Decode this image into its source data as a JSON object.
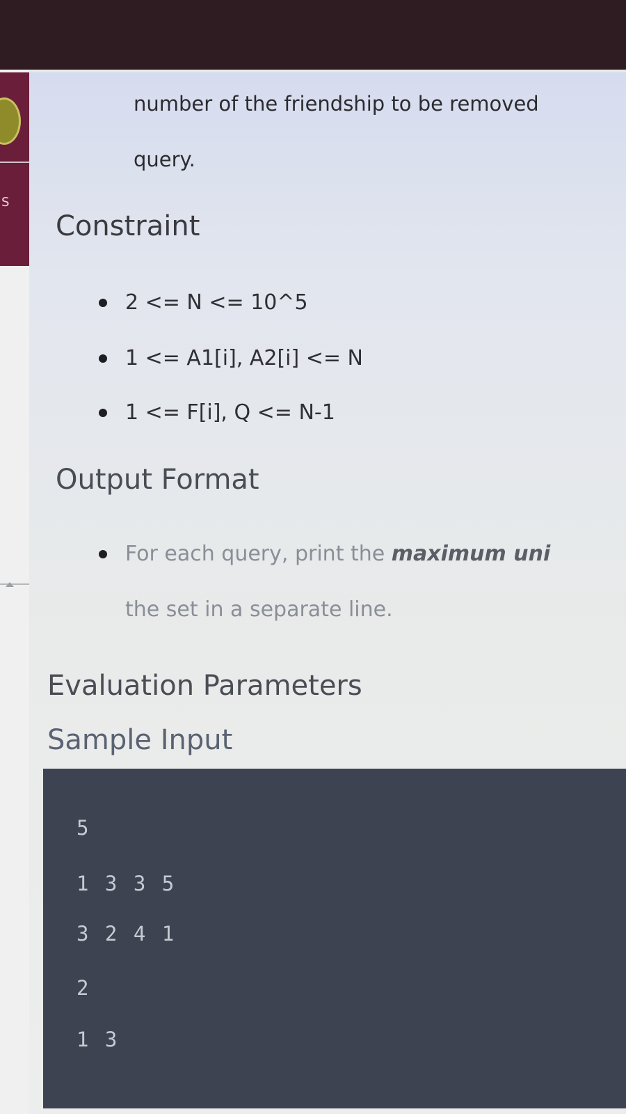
{
  "sidebar": {
    "partial_label": "S"
  },
  "problem": {
    "input_continuation": {
      "line1": "number of the friendship to be removed",
      "line2": "query."
    },
    "constraint": {
      "heading": "Constraint",
      "items": [
        "2 <= N <= 10^5",
        "1 <= A1[i], A2[i] <= N",
        "1 <= F[i], Q <= N-1"
      ]
    },
    "output_format": {
      "heading": "Output Format",
      "bullet_prefix": "For each query, print the ",
      "bullet_emphasis": "maximum uni",
      "bullet_line2": "the set in a separate line."
    },
    "evaluation": {
      "heading": "Evaluation Parameters"
    },
    "sample_input": {
      "heading": "Sample Input",
      "lines": [
        "5",
        "1 3 3 5",
        "3 2 4 1",
        "2",
        "1 3"
      ]
    }
  },
  "colors": {
    "topbar": "#2f1b22",
    "sidebar_accent": "#6b1e3a",
    "code_background": "#3d4350",
    "code_text": "#c6cbd3"
  }
}
